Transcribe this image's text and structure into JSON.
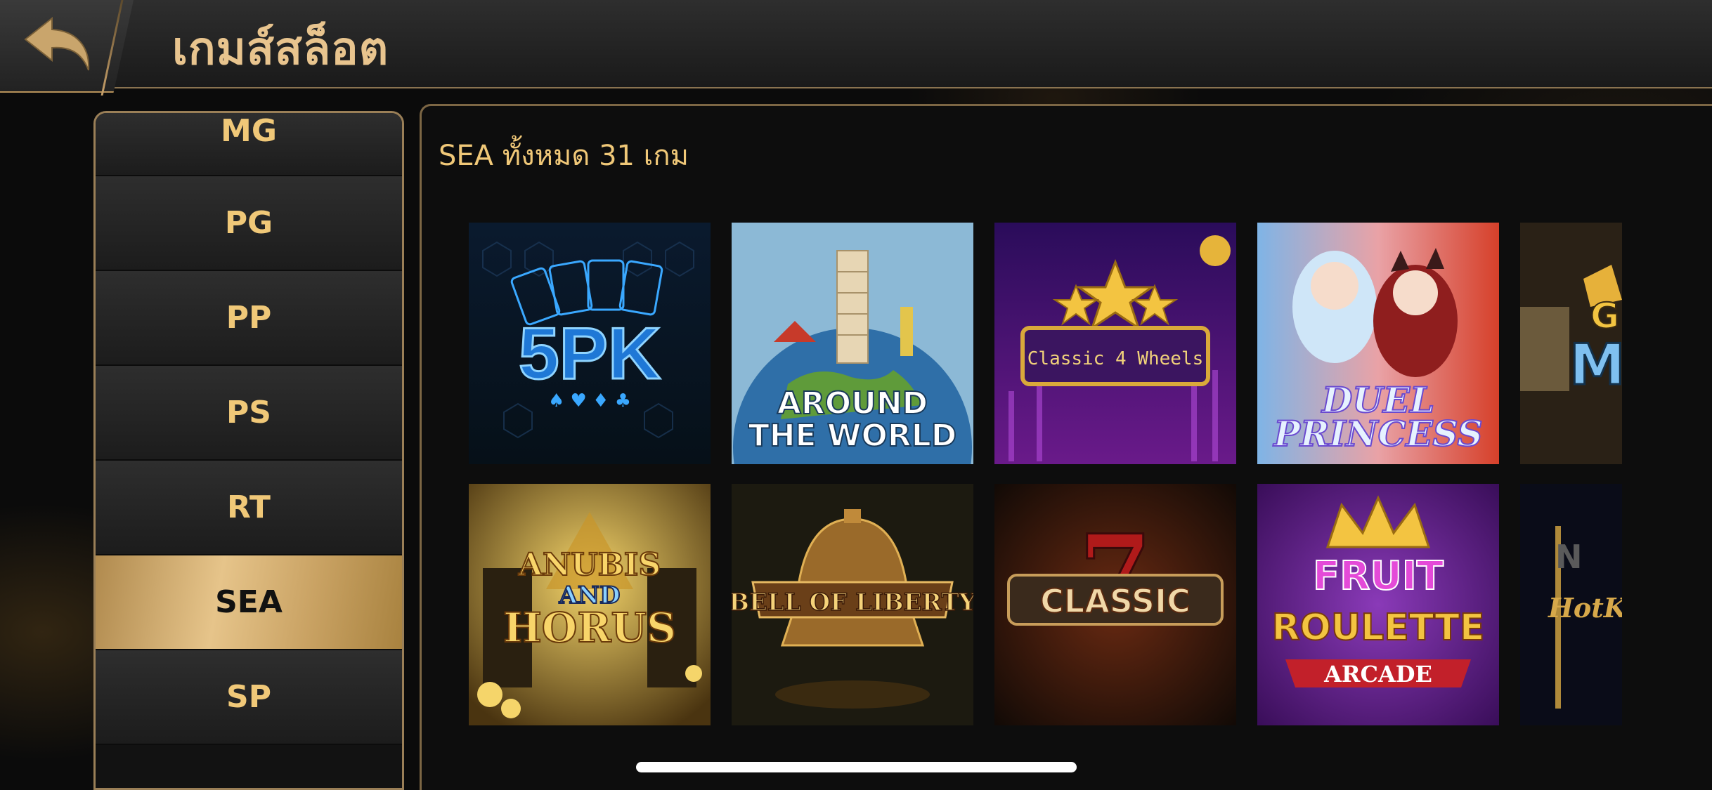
{
  "header": {
    "title": "เกมส์สล็อต",
    "back_icon": "back-arrow-icon"
  },
  "sidebar": {
    "items": [
      {
        "label": "MG"
      },
      {
        "label": "PG"
      },
      {
        "label": "PP"
      },
      {
        "label": "PS"
      },
      {
        "label": "RT"
      },
      {
        "label": "SEA",
        "active": true
      },
      {
        "label": "SP"
      }
    ]
  },
  "main": {
    "count_text": "SEA ทั้งหมด 31 เกม",
    "games": [
      {
        "title_lines": [
          "5PK"
        ]
      },
      {
        "title_lines": [
          "AROUND",
          "THE WORLD"
        ]
      },
      {
        "title_lines": [
          "Classic 4 Wheels"
        ]
      },
      {
        "title_lines": [
          "DUEL",
          "PRINCESS"
        ]
      },
      {
        "title_lines": [
          "G",
          "MI"
        ]
      },
      {
        "title_lines": [
          "ANUBIS",
          "AND",
          "HORUS"
        ]
      },
      {
        "title_lines": [
          "BELL OF LIBERTY"
        ]
      },
      {
        "title_lines": [
          "7",
          "CLASSIC"
        ]
      },
      {
        "title_lines": [
          "FRUIT",
          "ROULETTE",
          "ARCADE"
        ]
      },
      {
        "title_lines": [
          "N",
          "HotKe"
        ]
      }
    ]
  },
  "colors": {
    "accent_gold": "#f0c878",
    "active_tab": "#d9b472",
    "background": "#0b0b0b"
  }
}
